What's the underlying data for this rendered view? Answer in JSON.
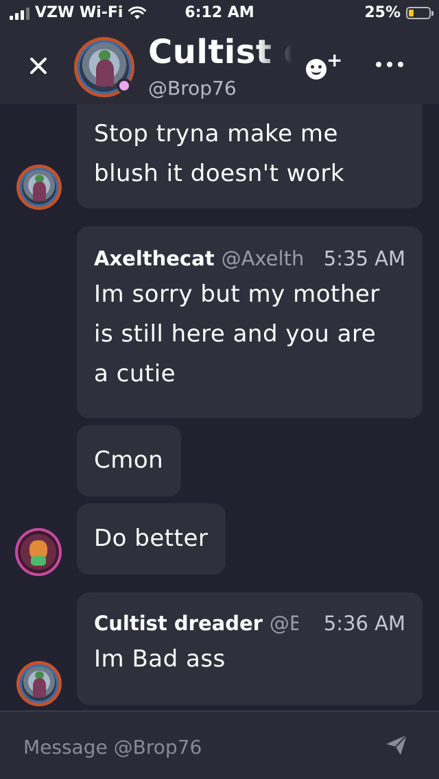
{
  "status_bar": {
    "carrier": "VZW Wi-Fi",
    "time": "6:12 AM",
    "battery_percent": "25%",
    "battery_level": 0.25
  },
  "header": {
    "title": "Cultist d",
    "handle": "@Brop76",
    "status_color": "#f0a5f0"
  },
  "messages": [
    {
      "type": "continuation",
      "lines": [
        "Stop tryna make me",
        "blush it doesn't work"
      ]
    },
    {
      "type": "full",
      "author": "Axelthecat",
      "handle": "@Axelth",
      "time": "5:35 AM",
      "lines": [
        "Im sorry but my mother",
        "is still here and you are",
        "a cutie"
      ]
    },
    {
      "type": "continuation",
      "lines": [
        "Cmon"
      ]
    },
    {
      "type": "continuation",
      "lines": [
        "Do better"
      ]
    },
    {
      "type": "full",
      "author": "Cultist dreader",
      "handle": "@B",
      "time": "5:36 AM",
      "lines": [
        "Im Bad ass"
      ]
    }
  ],
  "composer": {
    "placeholder": "Message @Brop76"
  },
  "icons": [
    "close-icon",
    "add-friend-icon",
    "more-icon",
    "send-icon",
    "wifi-icon",
    "signal-icon",
    "battery-icon"
  ],
  "colors": {
    "background": "#212130",
    "header": "#2b2b37",
    "bubble": "#30303d",
    "battery": "#f5c518",
    "cultist_avatar_ring": "#c0532e",
    "cat_avatar_ring": "#c64aa0"
  }
}
